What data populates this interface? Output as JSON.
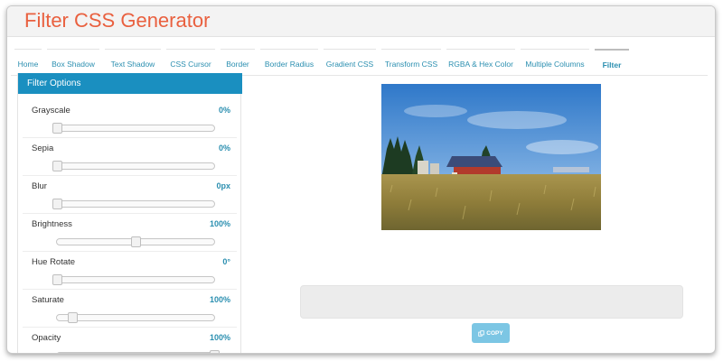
{
  "app": {
    "title": "Filter CSS Generator"
  },
  "nav": {
    "tabs": [
      {
        "label": "Home"
      },
      {
        "label": "Box Shadow"
      },
      {
        "label": "Text Shadow"
      },
      {
        "label": "CSS Cursor"
      },
      {
        "label": "Border"
      },
      {
        "label": "Border Radius"
      },
      {
        "label": "Gradient CSS"
      },
      {
        "label": "Transform CSS"
      },
      {
        "label": "RGBA & Hex Color"
      },
      {
        "label": "Multiple Columns"
      },
      {
        "label": "Filter",
        "active": true
      }
    ]
  },
  "panel": {
    "title": "Filter Options",
    "options": [
      {
        "label": "Grayscale",
        "value": "0%",
        "slider_fraction": 0.0
      },
      {
        "label": "Sepia",
        "value": "0%",
        "slider_fraction": 0.0
      },
      {
        "label": "Blur",
        "value": "0px",
        "slider_fraction": 0.0
      },
      {
        "label": "Brightness",
        "value": "100%",
        "slider_fraction": 0.5
      },
      {
        "label": "Hue Rotate",
        "value": "0°",
        "slider_fraction": 0.0
      },
      {
        "label": "Saturate",
        "value": "100%",
        "slider_fraction": 0.1
      },
      {
        "label": "Opacity",
        "value": "100%",
        "slider_fraction": 1.0
      }
    ]
  },
  "output": {
    "css_text": ""
  },
  "actions": {
    "copy_label": "COPY",
    "copy_icon": "copy-icon"
  },
  "colors": {
    "accent": "#1a8fc0",
    "title": "#e9603f",
    "link": "#2b8fb0",
    "copy_button": "#7cc6e4"
  }
}
